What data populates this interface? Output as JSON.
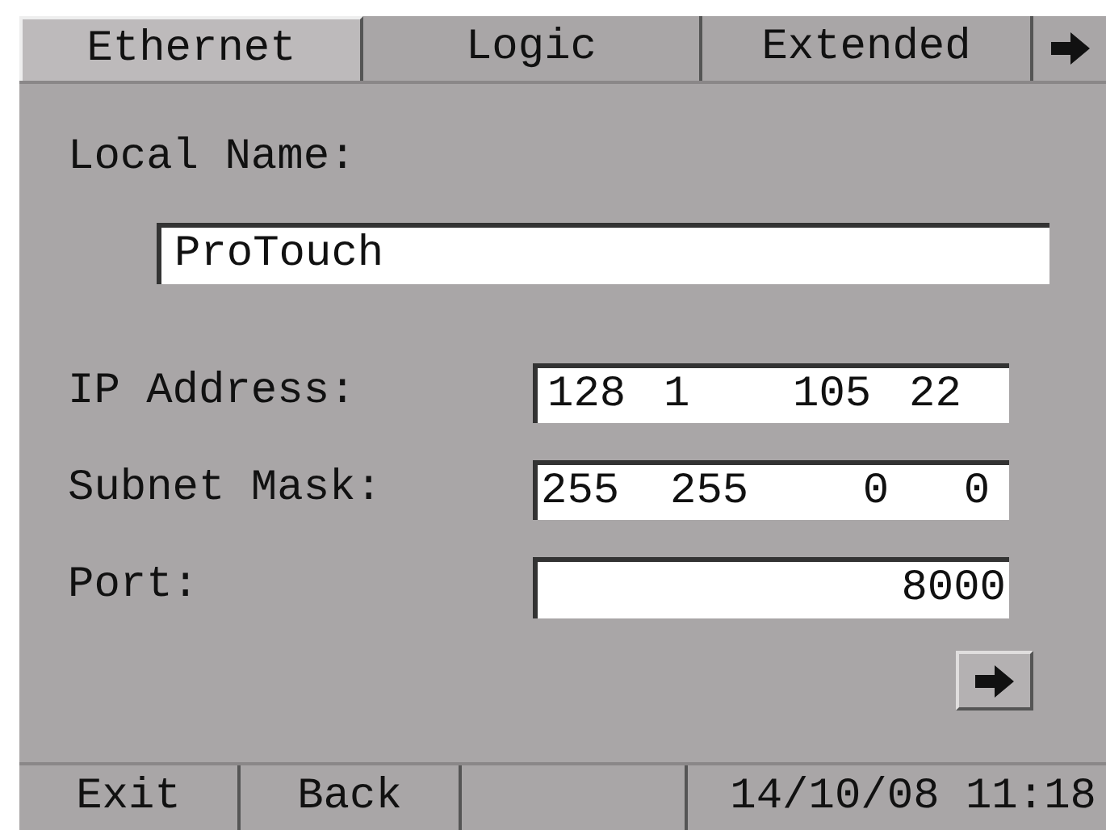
{
  "tabs": [
    {
      "label": "Ethernet",
      "selected": true
    },
    {
      "label": "Logic",
      "selected": false
    },
    {
      "label": "Extended",
      "selected": false
    }
  ],
  "local_name": {
    "label": "Local Name:",
    "value": "ProTouch"
  },
  "ip_address": {
    "label": "IP Address:",
    "octets": [
      "128",
      "1",
      "105",
      "22"
    ]
  },
  "subnet_mask": {
    "label": "Subnet Mask:",
    "octets": [
      "255",
      "255",
      "0",
      "0"
    ]
  },
  "port": {
    "label": "Port:",
    "value": "8000"
  },
  "footer": {
    "buttons": [
      "Exit",
      "Back"
    ],
    "datetime": "14/10/08 11:18"
  }
}
